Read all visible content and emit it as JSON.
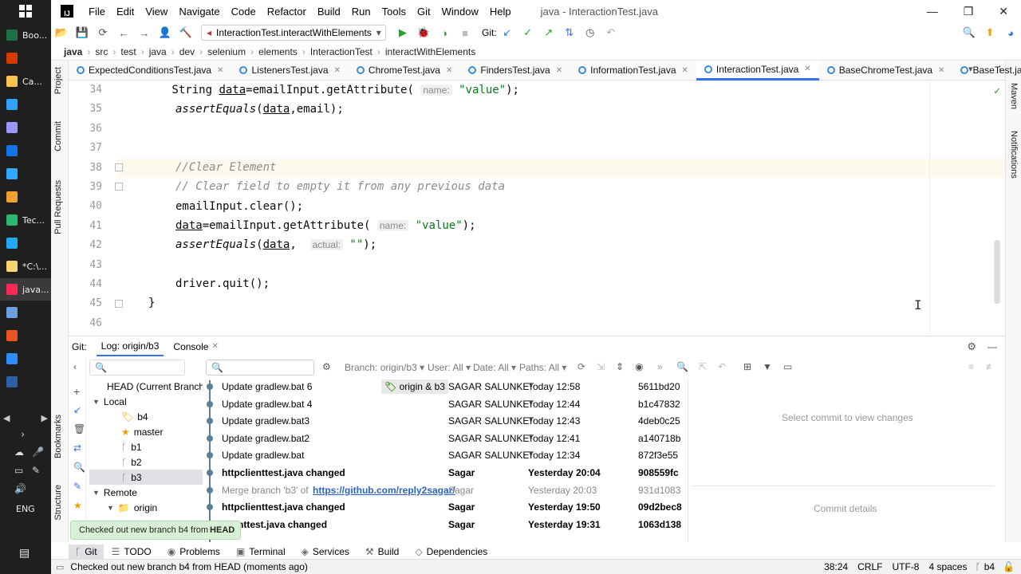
{
  "taskbar": {
    "items": [
      {
        "label": "Boo...",
        "icon": "excel-icon",
        "color": "#1e7145"
      },
      {
        "label": "",
        "icon": "office-icon",
        "color": "#d83b01"
      },
      {
        "label": "Ca...",
        "icon": "folder-icon",
        "color": "#f8c54c"
      },
      {
        "label": "",
        "icon": "photoshop-icon",
        "color": "#2fa3f7"
      },
      {
        "label": "",
        "icon": "after-effects-icon",
        "color": "#9999ff"
      },
      {
        "label": "",
        "icon": "media-encoder-icon",
        "color": "#1473e6"
      },
      {
        "label": "",
        "icon": "lightroom-icon",
        "color": "#31a8ff"
      },
      {
        "label": "",
        "icon": "git-icon",
        "color": "#f0a030"
      },
      {
        "label": "Tec...",
        "icon": "camtasia-icon",
        "color": "#2bb673"
      },
      {
        "label": "",
        "icon": "vscode-icon",
        "color": "#23a9f2"
      },
      {
        "label": "*C:\\...",
        "icon": "notepad-icon",
        "color": "#f5d76e"
      },
      {
        "label": "java...",
        "icon": "intellij-icon",
        "color": "#fe2857"
      },
      {
        "label": "",
        "icon": "notes-icon",
        "color": "#6c9ee0"
      },
      {
        "label": "",
        "icon": "ubuntu-icon",
        "color": "#e95420"
      },
      {
        "label": "",
        "icon": "zoom-icon",
        "color": "#2d8cff"
      },
      {
        "label": "",
        "icon": "powershell-icon",
        "color": "#2d5fa8"
      }
    ],
    "lang": "ENG"
  },
  "title": {
    "menu": [
      "File",
      "Edit",
      "View",
      "Navigate",
      "Code",
      "Refactor",
      "Build",
      "Run",
      "Tools",
      "Git",
      "Window",
      "Help"
    ],
    "window_title": "java - InteractionTest.java"
  },
  "toolbar": {
    "run_config": "InteractionTest.interactWithElements",
    "git_label": "Git:"
  },
  "breadcrumb": [
    "java",
    "src",
    "test",
    "java",
    "dev",
    "selenium",
    "elements",
    "InteractionTest",
    "interactWithElements"
  ],
  "left_tools": [
    "Project",
    "Commit",
    "Pull Requests",
    "Bookmarks",
    "Structure"
  ],
  "right_tools": [
    "Maven",
    "Notifications"
  ],
  "tabs": [
    {
      "label": "ExpectedConditionsTest.java",
      "active": false
    },
    {
      "label": "ListenersTest.java",
      "active": false
    },
    {
      "label": "ChromeTest.java",
      "active": false
    },
    {
      "label": "FindersTest.java",
      "active": false
    },
    {
      "label": "InformationTest.java",
      "active": false
    },
    {
      "label": "InteractionTest.java",
      "active": true
    },
    {
      "label": "BaseChromeTest.java",
      "active": false
    },
    {
      "label": "BaseTest.java",
      "active": false
    }
  ],
  "editor": {
    "line_numbers": [
      "34",
      "35",
      "36",
      "37",
      "38",
      "39",
      "40",
      "41",
      "42",
      "43",
      "44",
      "45",
      "46"
    ],
    "lines": {
      "l34a": "        String ",
      "l34b": "data",
      "l34c": "=emailInput.getAttribute( ",
      "l34hint": "name:",
      "l34str": " \"value\"",
      "l34d": ");",
      "l35a": "assertEquals",
      "l35b": "(",
      "l35c": "data",
      "l35d": ",email);",
      "l38": "//Clear Element",
      "l39": "// Clear field to empty it from any previous data",
      "l40": "emailInput.clear();",
      "l41a": "data",
      "l41b": "=emailInput.getAttribute( ",
      "l41hint": "name:",
      "l41str": " \"value\"",
      "l41c": ");",
      "l42a": "assertEquals",
      "l42b": "(",
      "l42c": "data",
      "l42d": ",  ",
      "l42hint": "actual:",
      "l42str": " \"\"",
      "l42e": ");",
      "l44": "driver.quit();",
      "l45": "}"
    }
  },
  "git": {
    "label": "Git:",
    "tab_log": "Log: origin/b3",
    "tab_console": "Console",
    "filters": {
      "branch": "Branch: origin/b3",
      "user": "User: All",
      "date": "Date: All",
      "paths": "Paths: All"
    },
    "branches": {
      "head": "HEAD (Current Branch)",
      "local": "Local",
      "local_items": [
        "b4",
        "master",
        "b1",
        "b2",
        "b3"
      ],
      "remote": "Remote",
      "remote_items": [
        "origin"
      ]
    },
    "commits": [
      {
        "msg": "Update gradlew.bat 6",
        "tag": "origin & b3",
        "author": "SAGAR SALUNKE*",
        "date": "Today 12:58",
        "hash": "5611bd20",
        "bold": false
      },
      {
        "msg": "Update gradlew.bat 4",
        "tag": "",
        "author": "SAGAR SALUNKE*",
        "date": "Today 12:44",
        "hash": "b1c47832",
        "bold": false
      },
      {
        "msg": "Update gradlew.bat3",
        "tag": "",
        "author": "SAGAR SALUNKE*",
        "date": "Today 12:43",
        "hash": "4deb0c25",
        "bold": false
      },
      {
        "msg": "Update gradlew.bat2",
        "tag": "",
        "author": "SAGAR SALUNKE*",
        "date": "Today 12:41",
        "hash": "a140718b",
        "bold": false
      },
      {
        "msg": "Update gradlew.bat",
        "tag": "",
        "author": "SAGAR SALUNKE*",
        "date": "Today 12:34",
        "hash": "872f3e55",
        "bold": false
      },
      {
        "msg": "httpclienttest.java changed",
        "tag": "",
        "author": "Sagar",
        "date": "Yesterday 20:04",
        "hash": "908559fc",
        "bold": true
      },
      {
        "msg": "Merge branch 'b3' of ",
        "link": "https://github.com/reply2sagar/",
        "tag": "",
        "author": "Sagar",
        "date": "Yesterday 20:03",
        "hash": "931d1083",
        "bold": false,
        "gray": true
      },
      {
        "msg": "httpclienttest.java changed",
        "tag": "",
        "author": "Sagar",
        "date": "Yesterday 19:50",
        "hash": "09d2bec8",
        "bold": true
      },
      {
        "msg": "clienttest.java changed",
        "tag": "",
        "author": "Sagar",
        "date": "Yesterday 19:31",
        "hash": "1063d138",
        "bold": true
      }
    ],
    "select_commit": "Select commit to view changes",
    "commit_details": "Commit details"
  },
  "toast": {
    "text": "Checked out new branch b4 from ",
    "bold": "HEAD"
  },
  "bottom_tabs": [
    "Git",
    "TODO",
    "Problems",
    "Terminal",
    "Services",
    "Build",
    "Dependencies"
  ],
  "status": {
    "message": "Checked out new branch b4 from HEAD (moments ago)",
    "position": "38:24",
    "line_sep": "CRLF",
    "encoding": "UTF-8",
    "indent": "4 spaces",
    "branch": "b4"
  }
}
